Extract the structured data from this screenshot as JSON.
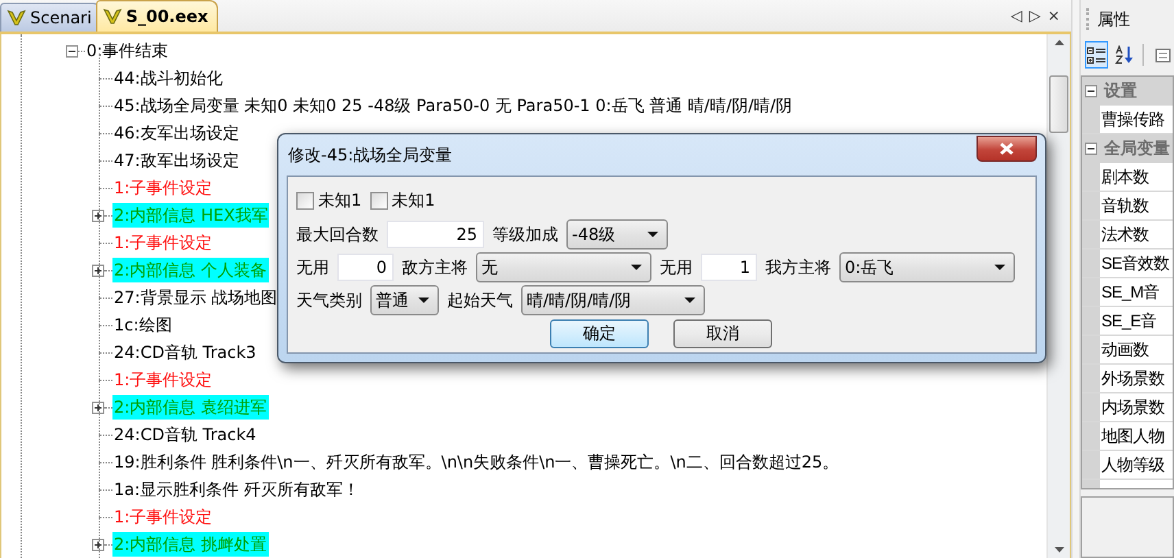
{
  "editor": {
    "tabs": [
      {
        "label": "Scenari",
        "selected": false
      },
      {
        "label": "S_00.eex",
        "selected": true
      }
    ],
    "tab_controls": [
      "◁",
      "▷",
      "×"
    ],
    "tree": {
      "label": "0:事件结束",
      "expanded": true,
      "children": [
        {
          "kind": "command",
          "label": "44:战斗初始化"
        },
        {
          "kind": "command",
          "label": "45:战场全局变量 未知0 未知0 25 -48级 Para50-0 无 Para50-1 0:岳飞 普通 晴/晴/阴/晴/阴"
        },
        {
          "kind": "command",
          "label": "46:友军出场设定"
        },
        {
          "kind": "command",
          "label": "47:敌军出场设定"
        },
        {
          "kind": "sub_event",
          "label": "1:子事件设定"
        },
        {
          "kind": "info",
          "label": "2:内部信息 HEX我军",
          "expanded": false
        },
        {
          "kind": "sub_event",
          "label": "1:子事件设定"
        },
        {
          "kind": "info",
          "label": "2:内部信息 个人装备",
          "expanded": false
        },
        {
          "kind": "command",
          "label": "27:背景显示 战场地图"
        },
        {
          "kind": "command",
          "label": "1c:绘图"
        },
        {
          "kind": "command",
          "label": "24:CD音轨 Track3"
        },
        {
          "kind": "sub_event",
          "label": "1:子事件设定"
        },
        {
          "kind": "info",
          "label": "2:内部信息 袁绍进军",
          "expanded": false
        },
        {
          "kind": "command",
          "label": "24:CD音轨 Track4"
        },
        {
          "kind": "command",
          "label": "19:胜利条件 胜利条件\\n一、歼灭所有敌军。\\n\\n失败条件\\n一、曹操死亡。\\n二、回合数超过25。"
        },
        {
          "kind": "command",
          "label": "1a:显示胜利条件 歼灭所有敌军！"
        },
        {
          "kind": "sub_event",
          "label": "1:子事件设定"
        },
        {
          "kind": "info",
          "label": "2:内部信息 挑衅处置",
          "expanded": false
        }
      ]
    }
  },
  "dialog": {
    "title": "修改-45:战场全局变量",
    "checkboxes": [
      {
        "label": "未知1",
        "checked": false
      },
      {
        "label": "未知1",
        "checked": false
      }
    ],
    "rows": [
      [
        {
          "kind": "label",
          "text": "最大回合数"
        },
        {
          "kind": "number",
          "value": "25"
        },
        {
          "kind": "label",
          "text": "等级加成"
        },
        {
          "kind": "combo",
          "value": "-48级"
        }
      ],
      [
        {
          "kind": "label",
          "text": "无用"
        },
        {
          "kind": "number",
          "value": "0"
        },
        {
          "kind": "label",
          "text": "敌方主将"
        },
        {
          "kind": "combo",
          "value": "无"
        },
        {
          "kind": "label",
          "text": "无用"
        },
        {
          "kind": "number",
          "value": "1"
        },
        {
          "kind": "label",
          "text": "我方主将"
        },
        {
          "kind": "combo",
          "value": "0:岳飞"
        }
      ],
      [
        {
          "kind": "label",
          "text": "天气类别"
        },
        {
          "kind": "combo",
          "value": "普通"
        },
        {
          "kind": "label",
          "text": "起始天气"
        },
        {
          "kind": "combo",
          "value": "晴/晴/阴/晴/阴"
        }
      ]
    ],
    "buttons": [
      {
        "label": "确定",
        "default": true
      },
      {
        "label": "取消",
        "default": false
      }
    ]
  },
  "properties": {
    "title": "属性",
    "categories": [
      {
        "label": "设置",
        "expanded": true,
        "items": [
          "曹操传路"
        ]
      },
      {
        "label": "全局变量",
        "expanded": true,
        "items": [
          "剧本数",
          "音轨数",
          "法术数",
          "SE音效数",
          "SE_M音",
          "SE_E音",
          "动画数",
          "外场景数",
          "内场景数",
          "地图人物",
          "人物等级"
        ]
      }
    ]
  }
}
